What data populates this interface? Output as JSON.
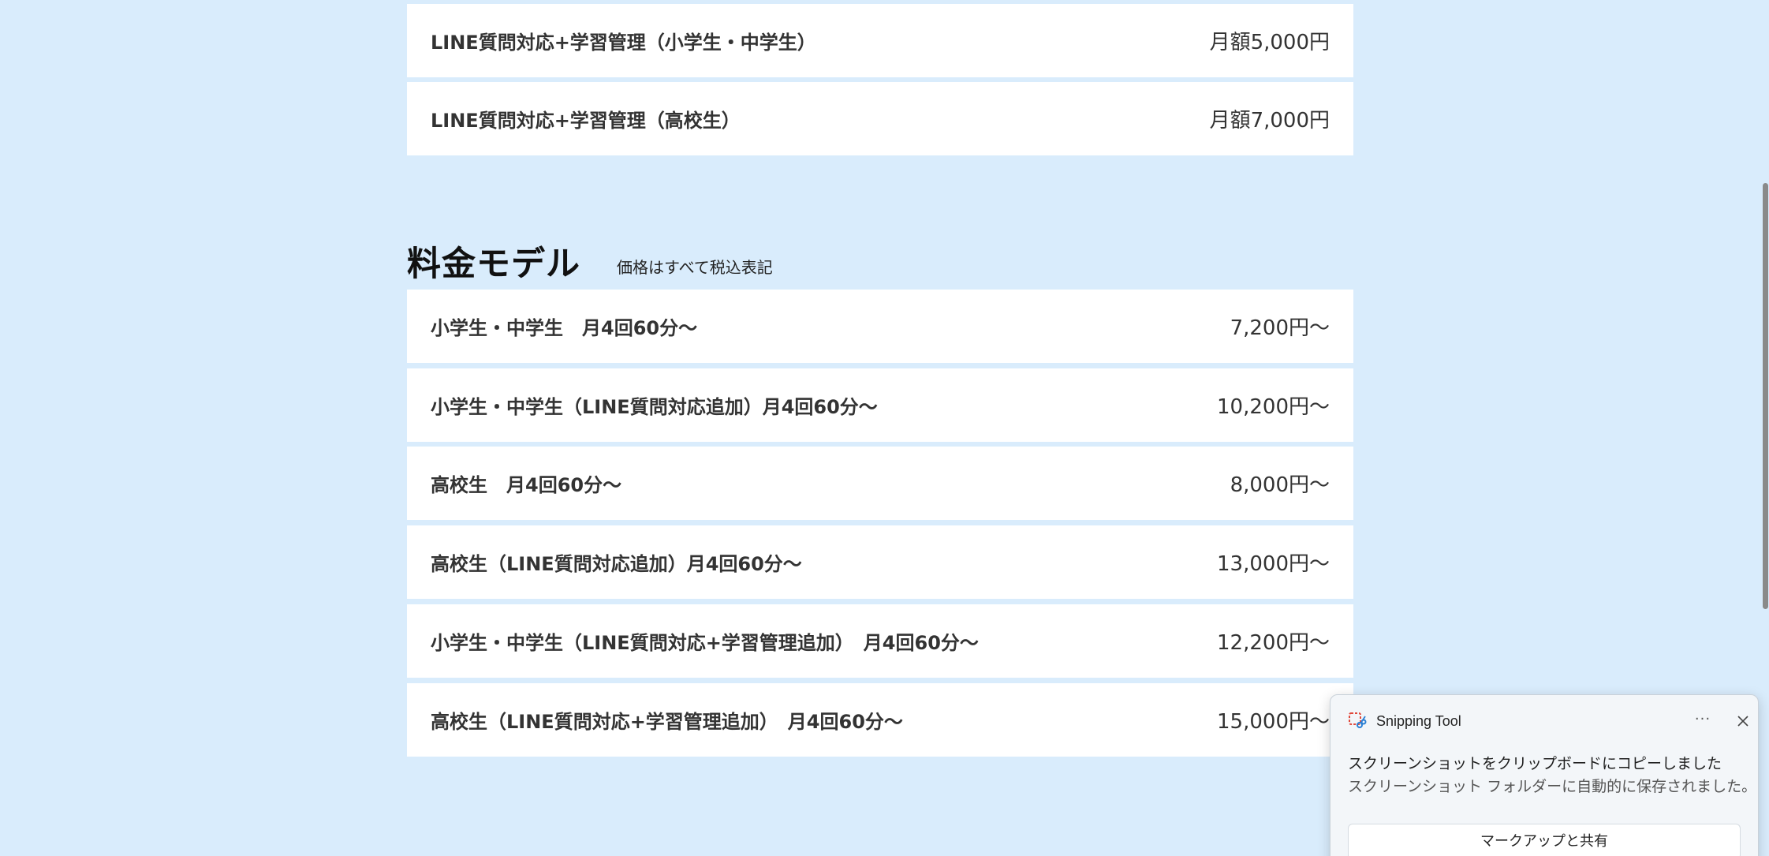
{
  "top_rows": [
    {
      "label": "LINE質問対応+学習管理（小学生・中学生）",
      "price": "月額5,000円"
    },
    {
      "label": "LINE質問対応+学習管理（高校生）",
      "price": "月額7,000円"
    }
  ],
  "pricing_section": {
    "title": "料金モデル",
    "note": "価格はすべて税込表記",
    "rows": [
      {
        "label": "小学生・中学生　月4回60分～",
        "price": "7,200円～"
      },
      {
        "label": "小学生・中学生（LINE質問対応追加）月4回60分～",
        "price": "10,200円～"
      },
      {
        "label": "高校生　月4回60分～",
        "price": "8,000円～"
      },
      {
        "label": "高校生（LINE質問対応追加）月4回60分～",
        "price": "13,000円～"
      },
      {
        "label": "小学生・中学生（LINE質問対応+学習管理追加）　月4回60分～",
        "price": "12,200円～"
      },
      {
        "label": "高校生（LINE質問対応+学習管理追加）　月4回60分～",
        "price": "15,000円～"
      }
    ]
  },
  "toast": {
    "app_name": "Snipping Tool",
    "more_label": "···",
    "message": "スクリーンショットをクリップボードにコピーしました",
    "submessage": "スクリーンショット フォルダーに自動的に保存されました。",
    "action_label": "マークアップと共有",
    "app_icon": "snipping-tool-icon",
    "close_icon": "close-icon"
  },
  "colors": {
    "background": "#d9ecfc",
    "row_background": "#ffffff",
    "text": "#333333"
  }
}
